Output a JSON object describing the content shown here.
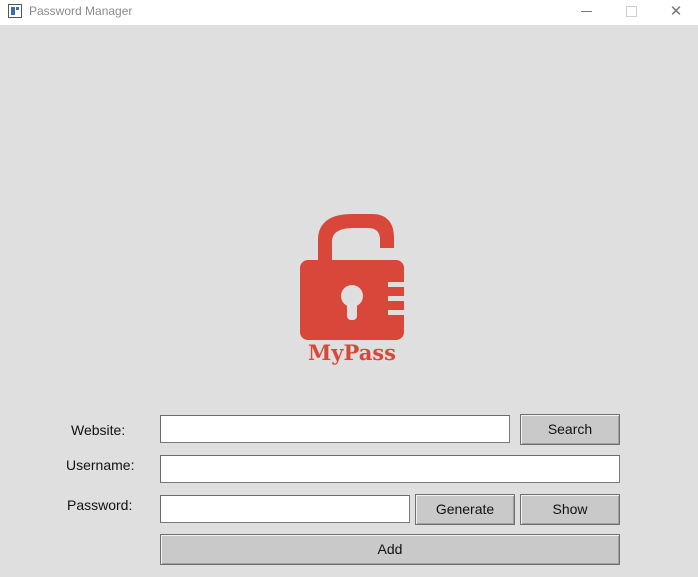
{
  "window": {
    "title": "Password Manager",
    "controls": {
      "minimize": "minimize-icon",
      "maximize": "maximize-icon",
      "close": "close-icon"
    }
  },
  "logo": {
    "text": "MyPass",
    "icon": "padlock-icon",
    "color": "#d9473a"
  },
  "form": {
    "website": {
      "label": "Website:",
      "value": "",
      "placeholder": ""
    },
    "username": {
      "label": "Username:",
      "value": "",
      "placeholder": ""
    },
    "password": {
      "label": "Password:",
      "value": "",
      "placeholder": ""
    },
    "buttons": {
      "search": "Search",
      "generate": "Generate",
      "show": "Show",
      "add": "Add"
    }
  },
  "colors": {
    "background": "#dfdfdf",
    "button": "#c9c9c9"
  }
}
